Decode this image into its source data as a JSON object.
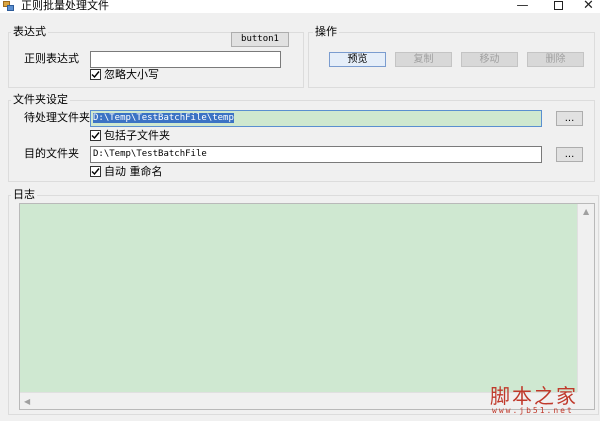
{
  "window": {
    "title": "正则批量处理文件",
    "minimize_glyph": "—",
    "close_glyph": "✕"
  },
  "expression_group": {
    "label": "表达式",
    "regex_label": "正则表达式",
    "regex_value": "",
    "ignore_case_label": "忽略大小写",
    "ignore_case_checked": true,
    "button1_label": "button1"
  },
  "operations_group": {
    "label": "操作",
    "buttons": [
      {
        "label": "预览",
        "enabled": true
      },
      {
        "label": "复制",
        "enabled": false
      },
      {
        "label": "移动",
        "enabled": false
      },
      {
        "label": "删除",
        "enabled": false
      }
    ]
  },
  "folder_group": {
    "label": "文件夹设定",
    "source_label": "待处理文件夹",
    "source_value": "D:\\Temp\\TestBatchFile\\temp",
    "browse_label": "...",
    "include_sub_label": "包括子文件夹",
    "include_sub_checked": true,
    "target_label": "目的文件夹",
    "target_value": "D:\\Temp\\TestBatchFile",
    "auto_rename_label": "自动 重命名",
    "auto_rename_checked": true
  },
  "log_group": {
    "label": "日志",
    "content": ""
  },
  "watermark": {
    "main": "脚本之家",
    "sub": "www.jb51.net"
  },
  "colors": {
    "log_background": "#cfe8d1",
    "active_field": "#cfe8cf",
    "watermark": "#c0392b"
  }
}
